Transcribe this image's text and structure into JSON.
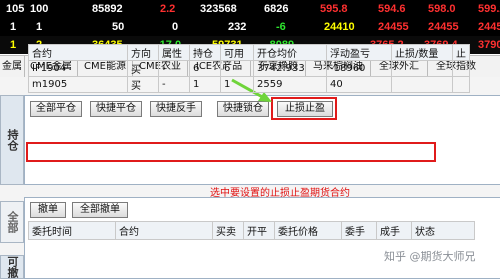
{
  "quote_rows": [
    {
      "cells": [
        {
          "text": "105",
          "color": "#ffffff"
        },
        {
          "text": "100",
          "color": "#ffffff"
        },
        {
          "text": "85892",
          "color": "#ffffff"
        },
        {
          "text": "2.2",
          "color": "#ff3030"
        },
        {
          "text": "323568",
          "color": "#ffffff"
        },
        {
          "text": "6826",
          "color": "#ffffff"
        },
        {
          "text": "595.8",
          "color": "#ff3030"
        },
        {
          "text": "594.6",
          "color": "#ff3030"
        },
        {
          "text": "598.0",
          "color": "#ff3030"
        },
        {
          "text": "599.2",
          "color": "#ff3030"
        }
      ]
    },
    {
      "cells": [
        {
          "text": "1",
          "color": "#ffffff"
        },
        {
          "text": "1",
          "color": "#ffffff"
        },
        {
          "text": "50",
          "color": "#ffffff"
        },
        {
          "text": "0",
          "color": "#ffffff"
        },
        {
          "text": "232",
          "color": "#ffffff"
        },
        {
          "text": "-6",
          "color": "#2ee52e"
        },
        {
          "text": "24410",
          "color": "#ffff00"
        },
        {
          "text": "24455",
          "color": "#ff3030"
        },
        {
          "text": "24455",
          "color": "#ff3030"
        },
        {
          "text": "2445",
          "color": "#ff3030"
        }
      ]
    },
    {
      "cells": [
        {
          "text": "1",
          "color": "#ffff00"
        },
        {
          "text": "2",
          "color": "#ffff00"
        },
        {
          "text": "36435",
          "color": "#ffff00"
        },
        {
          "text": "-17.0",
          "color": "#2ee52e"
        },
        {
          "text": "59731",
          "color": "#ffff00"
        },
        {
          "text": "-8089",
          "color": "#2ee52e"
        },
        {
          "text": "",
          "color": "#ffffff"
        },
        {
          "text": "3765.2",
          "color": "#ff3030"
        },
        {
          "text": "3769.4",
          "color": "#ff3030"
        },
        {
          "text": "3790",
          "color": "#ff3030"
        }
      ]
    }
  ],
  "market_tabs": [
    "金属",
    "CME金属",
    "CME能源",
    "CME农业",
    "ICE农产品",
    "东京橡胶",
    "马来棕榈油",
    "全球外汇",
    "全球指数"
  ],
  "side_tabs": {
    "position": "持仓",
    "all": "全部",
    "cancelable": "可撤"
  },
  "toolbar": {
    "close_all": "全部平仓",
    "quick_close": "快捷平仓",
    "quick_reverse": "快捷反手",
    "quick_lock": "快捷锁仓",
    "stop_loss_profit": "止损止盈"
  },
  "positions": {
    "headers": [
      "合约",
      "方向",
      "属性",
      "持仓",
      "可用",
      "开仓均价",
      "浮动盈亏",
      "止损/数量",
      "止"
    ],
    "rows": [
      {
        "contract": "IF1904",
        "direction": "买",
        "attribute": "-",
        "hold": "6",
        "available": "6",
        "avg_price": "3742.933",
        "float_pnl": "-18960",
        "stop": ""
      },
      {
        "contract": "m1905",
        "direction": "买",
        "attribute": "-",
        "hold": "1",
        "available": "1",
        "avg_price": "2559",
        "float_pnl": "40",
        "stop": ""
      }
    ]
  },
  "annotation": "选中要设置的止损止盈期货合约",
  "order_toolbar": {
    "cancel": "撤单",
    "cancel_all": "全部撤单"
  },
  "orders": {
    "headers": [
      "委托时间",
      "合约",
      "买卖",
      "开平",
      "委托价格",
      "委手",
      "成手",
      "状态"
    ]
  },
  "watermark": "知乎 @期货大师兄",
  "colors": {
    "annotation_red": "#e01b1b",
    "arrow_green": "#6fd43a",
    "gain_red": "#e01010",
    "loss_green": "#0c8a25"
  }
}
